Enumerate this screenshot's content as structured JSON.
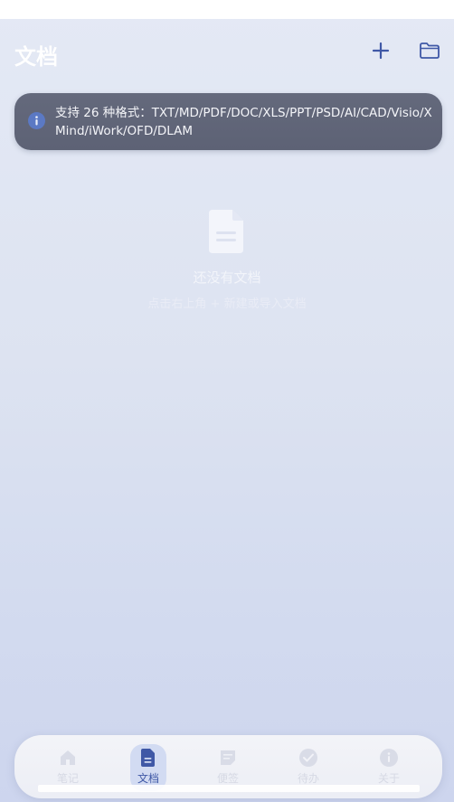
{
  "header": {
    "title": "文档",
    "add_icon": "plus-icon",
    "folder_icon": "folder-icon"
  },
  "banner": {
    "icon": "info-icon",
    "text": "支持 26 种格式：TXT/MD/PDF/DOC/XLS/PPT/PSD/AI/CAD/Visio/XMind/iWork/OFD/DLAM"
  },
  "empty_state": {
    "icon": "document-icon",
    "title": "还没有文档",
    "hint": "点击右上角 + 新建或导入文档"
  },
  "nav": {
    "items": [
      {
        "label": "笔记",
        "icon": "home-icon",
        "active": false
      },
      {
        "label": "文档",
        "icon": "document-icon",
        "active": true
      },
      {
        "label": "便签",
        "icon": "sticky-note-icon",
        "active": false
      },
      {
        "label": "待办",
        "icon": "check-circle-icon",
        "active": false
      },
      {
        "label": "关于",
        "icon": "info-icon",
        "active": false
      }
    ]
  },
  "colors": {
    "accent": "#3f58a6",
    "banner_bg": "#62677a",
    "banner_icon": "#5b79c4"
  }
}
